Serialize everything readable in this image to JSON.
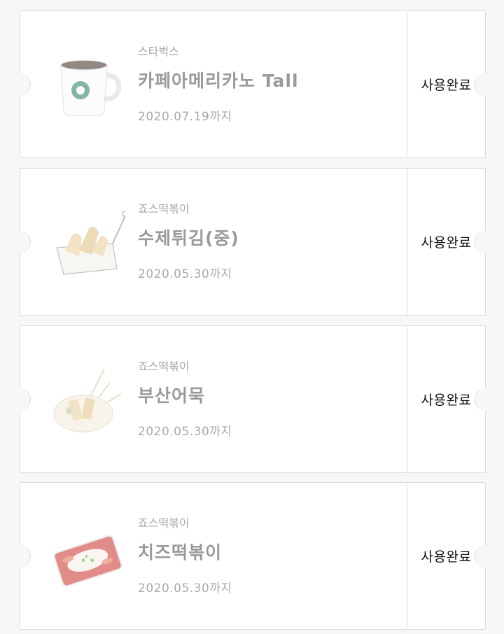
{
  "coupons": [
    {
      "brand": "스타벅스",
      "name": "카페아메리카노 Tall",
      "expiry": "2020.07.19까지",
      "status": "사용완료",
      "image_icon": "coffee-mug-icon"
    },
    {
      "brand": "죠스떡볶이",
      "name": "수제튀김(중)",
      "expiry": "2020.05.30까지",
      "status": "사용완료",
      "image_icon": "fried-food-basket-icon"
    },
    {
      "brand": "죠스떡볶이",
      "name": "부산어묵",
      "expiry": "2020.05.30까지",
      "status": "사용완료",
      "image_icon": "fishcake-bowl-icon"
    },
    {
      "brand": "죠스떡볶이",
      "name": "치즈떡볶이",
      "expiry": "2020.05.30까지",
      "status": "사용완료",
      "image_icon": "cheese-tteokbokki-icon"
    }
  ],
  "colors": {
    "page_bg": "#f7f7f7",
    "card_bg": "#ffffff",
    "border": "#dcdcdc",
    "faded_text": "#9a9a9a",
    "status_text": "#111111",
    "starbucks_green": "#1e7b57"
  }
}
